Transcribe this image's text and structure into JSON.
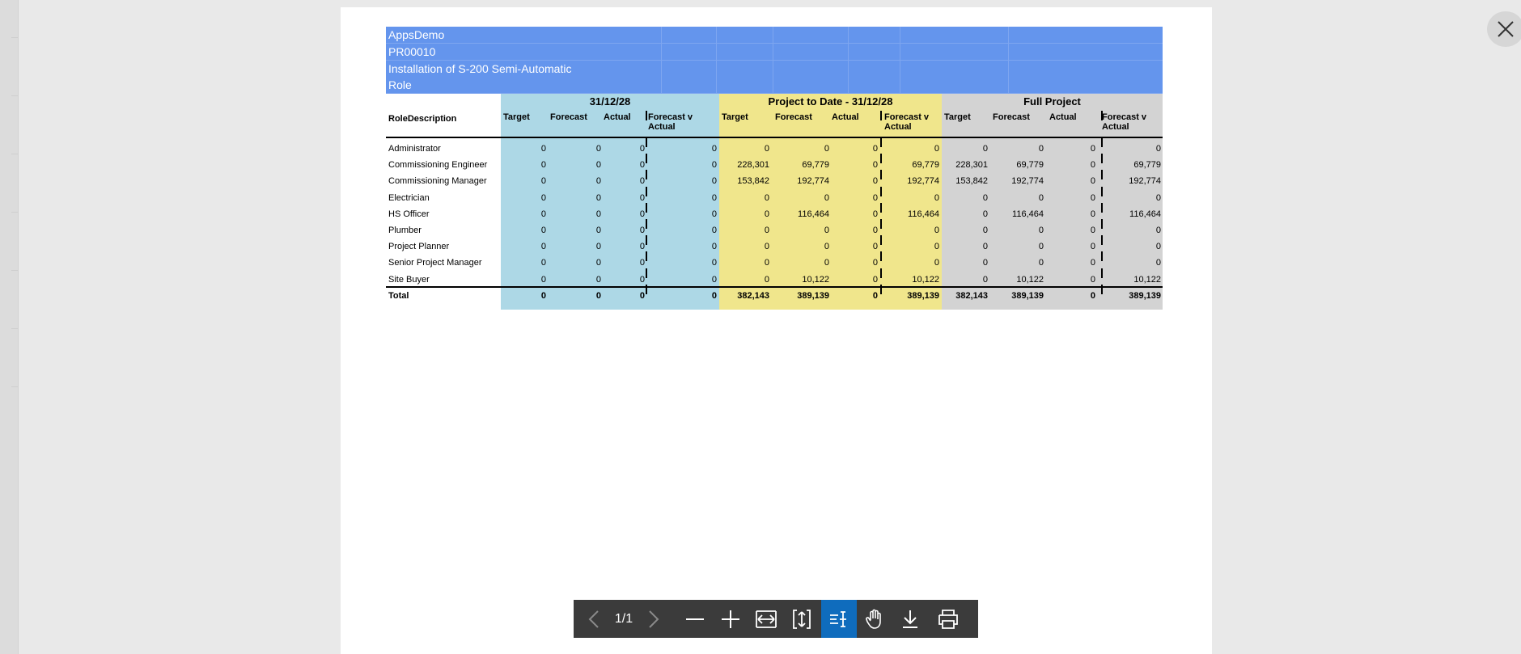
{
  "report": {
    "header_lines": [
      "AppsDemo",
      "PR00010",
      "Installation of S-200 Semi-Automatic",
      "Role"
    ],
    "role_header": "RoleDescription",
    "groups": [
      {
        "title": "31/12/28",
        "color": "#add8e6"
      },
      {
        "title": "Project to Date - 31/12/28",
        "color": "#f0e68c"
      },
      {
        "title": "Full Project",
        "color": "#d3d3d3"
      }
    ],
    "column_headers": [
      "Target",
      "Forecast",
      "Actual",
      "Forecast v Actual"
    ],
    "rows": [
      {
        "label": "Administrator",
        "values": [
          "0",
          "0",
          "0",
          "0",
          "0",
          "0",
          "0",
          "0",
          "0",
          "0",
          "0",
          "0"
        ]
      },
      {
        "label": "Commissioning Engineer",
        "values": [
          "0",
          "0",
          "0",
          "0",
          "228,301",
          "69,779",
          "0",
          "69,779",
          "228,301",
          "69,779",
          "0",
          "69,779"
        ]
      },
      {
        "label": "Commissioning Manager",
        "values": [
          "0",
          "0",
          "0",
          "0",
          "153,842",
          "192,774",
          "0",
          "192,774",
          "153,842",
          "192,774",
          "0",
          "192,774"
        ]
      },
      {
        "label": "Electrician",
        "values": [
          "0",
          "0",
          "0",
          "0",
          "0",
          "0",
          "0",
          "0",
          "0",
          "0",
          "0",
          "0"
        ]
      },
      {
        "label": "HS Officer",
        "values": [
          "0",
          "0",
          "0",
          "0",
          "0",
          "116,464",
          "0",
          "116,464",
          "0",
          "116,464",
          "0",
          "116,464"
        ]
      },
      {
        "label": "Plumber",
        "values": [
          "0",
          "0",
          "0",
          "0",
          "0",
          "0",
          "0",
          "0",
          "0",
          "0",
          "0",
          "0"
        ]
      },
      {
        "label": "Project Planner",
        "values": [
          "0",
          "0",
          "0",
          "0",
          "0",
          "0",
          "0",
          "0",
          "0",
          "0",
          "0",
          "0"
        ]
      },
      {
        "label": "Senior Project Manager",
        "values": [
          "0",
          "0",
          "0",
          "0",
          "0",
          "0",
          "0",
          "0",
          "0",
          "0",
          "0",
          "0"
        ]
      },
      {
        "label": "Site Buyer",
        "values": [
          "0",
          "0",
          "0",
          "0",
          "0",
          "10,122",
          "0",
          "10,122",
          "0",
          "10,122",
          "0",
          "10,122"
        ]
      },
      {
        "label": "Total",
        "values": [
          "0",
          "0",
          "0",
          "0",
          "382,143",
          "389,139",
          "0",
          "389,139",
          "382,143",
          "389,139",
          "0",
          "389,139"
        ]
      }
    ]
  },
  "toolbar": {
    "page_indicator": "1/1",
    "buttons": [
      "previous-page",
      "next-page",
      "zoom-out",
      "zoom-in",
      "fit-width",
      "fit-page",
      "text-select",
      "pan",
      "download",
      "print"
    ],
    "active_button": "text-select",
    "active_color": "#0f6cbd"
  }
}
